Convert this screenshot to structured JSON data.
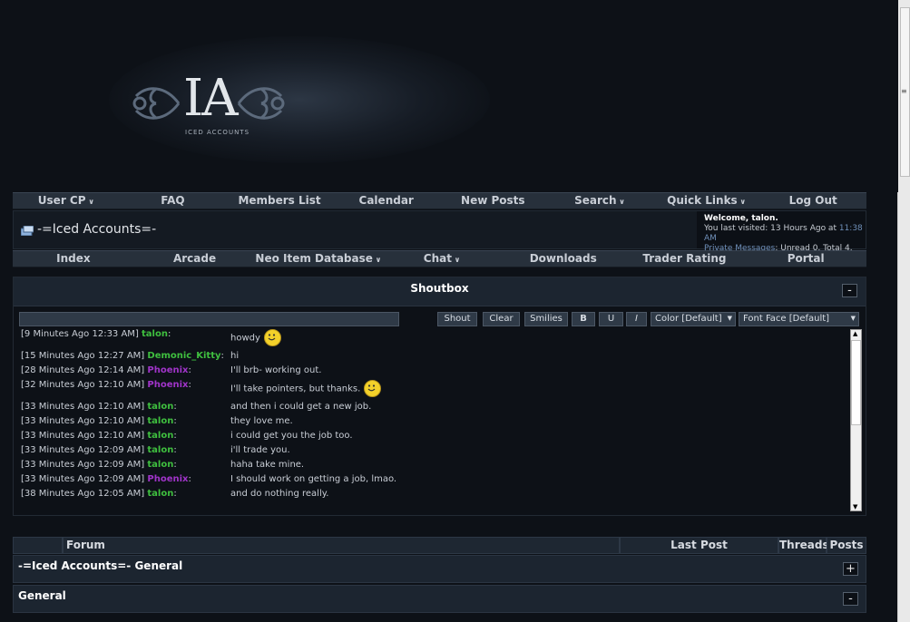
{
  "header": {
    "logo_text": "IA",
    "logo_subtitle": "ICED ACCOUNTS"
  },
  "top_nav": [
    {
      "label": "User CP",
      "dropdown": true
    },
    {
      "label": "FAQ",
      "dropdown": false
    },
    {
      "label": "Members List",
      "dropdown": false
    },
    {
      "label": "Calendar",
      "dropdown": false
    },
    {
      "label": "New Posts",
      "dropdown": false
    },
    {
      "label": "Search",
      "dropdown": true
    },
    {
      "label": "Quick Links",
      "dropdown": true
    },
    {
      "label": "Log Out",
      "dropdown": false
    }
  ],
  "breadcrumb": {
    "title": "-=Iced Accounts=-"
  },
  "welcome": {
    "line1": "Welcome, talon.",
    "visited_prefix": "You last visited: 13 Hours Ago at ",
    "visited_time": "11:38 AM",
    "pm_label": "Private Messages",
    "pm_status": ": Unread 0, Total 4."
  },
  "sub_nav": [
    {
      "label": "Index",
      "dropdown": false
    },
    {
      "label": "Arcade",
      "dropdown": false
    },
    {
      "label": "Neo Item Database",
      "dropdown": true
    },
    {
      "label": "Chat",
      "dropdown": true
    },
    {
      "label": "Downloads",
      "dropdown": false
    },
    {
      "label": "Trader Rating",
      "dropdown": false
    },
    {
      "label": "Portal",
      "dropdown": false
    }
  ],
  "shoutbox": {
    "title": "Shoutbox",
    "collapse_symbol": "-",
    "buttons": {
      "shout": "Shout",
      "clear": "Clear",
      "smilies": "Smilies",
      "bold": "B",
      "underline": "U",
      "italic": "I"
    },
    "color_select": "Color [Default]",
    "font_select": "Font Face [Default]",
    "dropdown_glyph": "▼",
    "shouts": [
      {
        "time": "[9 Minutes Ago 12:33 AM]",
        "user": "talon",
        "color": "#3fbf3f",
        "message": "howdy",
        "smiley": true
      },
      {
        "time": "[15 Minutes Ago 12:27 AM]",
        "user": "Demonic_Kitty",
        "color": "#3fbf3f",
        "message": "hi",
        "smiley": false
      },
      {
        "time": "[28 Minutes Ago 12:14 AM]",
        "user": "Phoenix",
        "color": "#a034c9",
        "message": "I'll brb- working out.",
        "smiley": false
      },
      {
        "time": "[32 Minutes Ago 12:10 AM]",
        "user": "Phoenix",
        "color": "#a034c9",
        "message": "I'll take pointers, but thanks.",
        "smiley": true
      },
      {
        "time": "[33 Minutes Ago 12:10 AM]",
        "user": "talon",
        "color": "#3fbf3f",
        "message": "and then i could get a new job.",
        "smiley": false
      },
      {
        "time": "[33 Minutes Ago 12:10 AM]",
        "user": "talon",
        "color": "#3fbf3f",
        "message": "they love me.",
        "smiley": false
      },
      {
        "time": "[33 Minutes Ago 12:10 AM]",
        "user": "talon",
        "color": "#3fbf3f",
        "message": "i could get you the job too.",
        "smiley": false
      },
      {
        "time": "[33 Minutes Ago 12:09 AM]",
        "user": "talon",
        "color": "#3fbf3f",
        "message": "i'll trade you.",
        "smiley": false
      },
      {
        "time": "[33 Minutes Ago 12:09 AM]",
        "user": "talon",
        "color": "#3fbf3f",
        "message": "haha take mine.",
        "smiley": false
      },
      {
        "time": "[33 Minutes Ago 12:09 AM]",
        "user": "Phoenix",
        "color": "#a034c9",
        "message": "I should work on getting a job, lmao.",
        "smiley": false
      },
      {
        "time": "[38 Minutes Ago 12:05 AM]",
        "user": "talon",
        "color": "#3fbf3f",
        "message": "and do nothing really.",
        "smiley": false
      }
    ]
  },
  "forum_table": {
    "columns": {
      "forum": "Forum",
      "last_post": "Last Post",
      "threads": "Threads",
      "posts": "Posts"
    },
    "categories": [
      {
        "name": "-=Iced Accounts=- General",
        "toggle": "+"
      },
      {
        "name": "General",
        "toggle": "-"
      }
    ]
  },
  "colors": {
    "accent_blue": "#6f8fb8",
    "user_green": "#3fbf3f",
    "user_purple": "#a034c9"
  }
}
